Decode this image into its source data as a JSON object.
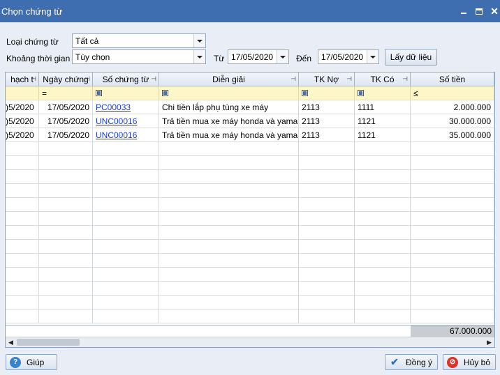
{
  "window": {
    "title": "Chọn chứng từ"
  },
  "form": {
    "type_label": "Loại chứng từ",
    "type_value": "Tất cả",
    "period_label": "Khoảng thời gian",
    "period_value": "Tùy chọn",
    "from_label": "Từ",
    "from_value": "17/05/2020",
    "to_label": "Đến",
    "to_value": "17/05/2020",
    "get_data_label": "Lấy dữ liệu"
  },
  "grid": {
    "columns": [
      "hạch t",
      "Ngày chứng",
      "Số chứng từ",
      "Diễn giải",
      "TK Nợ",
      "TK Có",
      "Số tiền"
    ],
    "filter_ops": {
      "date": "=",
      "amount": "≤"
    },
    "rows": [
      {
        "d1": ")5/2020",
        "date": "17/05/2020",
        "num": "PC00033",
        "desc": "Chi tiền lắp phụ tùng xe máy",
        "debit": "2113",
        "credit": "1111",
        "amount": "2.000.000"
      },
      {
        "d1": ")5/2020",
        "date": "17/05/2020",
        "num": "UNC00016",
        "desc": "Trả tiền mua xe máy honda và yama...",
        "debit": "2113",
        "credit": "1121",
        "amount": "30.000.000"
      },
      {
        "d1": ")5/2020",
        "date": "17/05/2020",
        "num": "UNC00016",
        "desc": "Trả tiền mua xe máy honda và yama...",
        "debit": "2113",
        "credit": "1121",
        "amount": "35.000.000"
      }
    ],
    "total_amount": "67.000.000"
  },
  "footer": {
    "help_label": "Giúp",
    "ok_label": "Đồng ý",
    "cancel_label": "Hủy bỏ"
  },
  "colors": {
    "titlebar": "#3f6eb0",
    "filter_row": "#fdf6c8",
    "link": "#1a3fcc"
  }
}
